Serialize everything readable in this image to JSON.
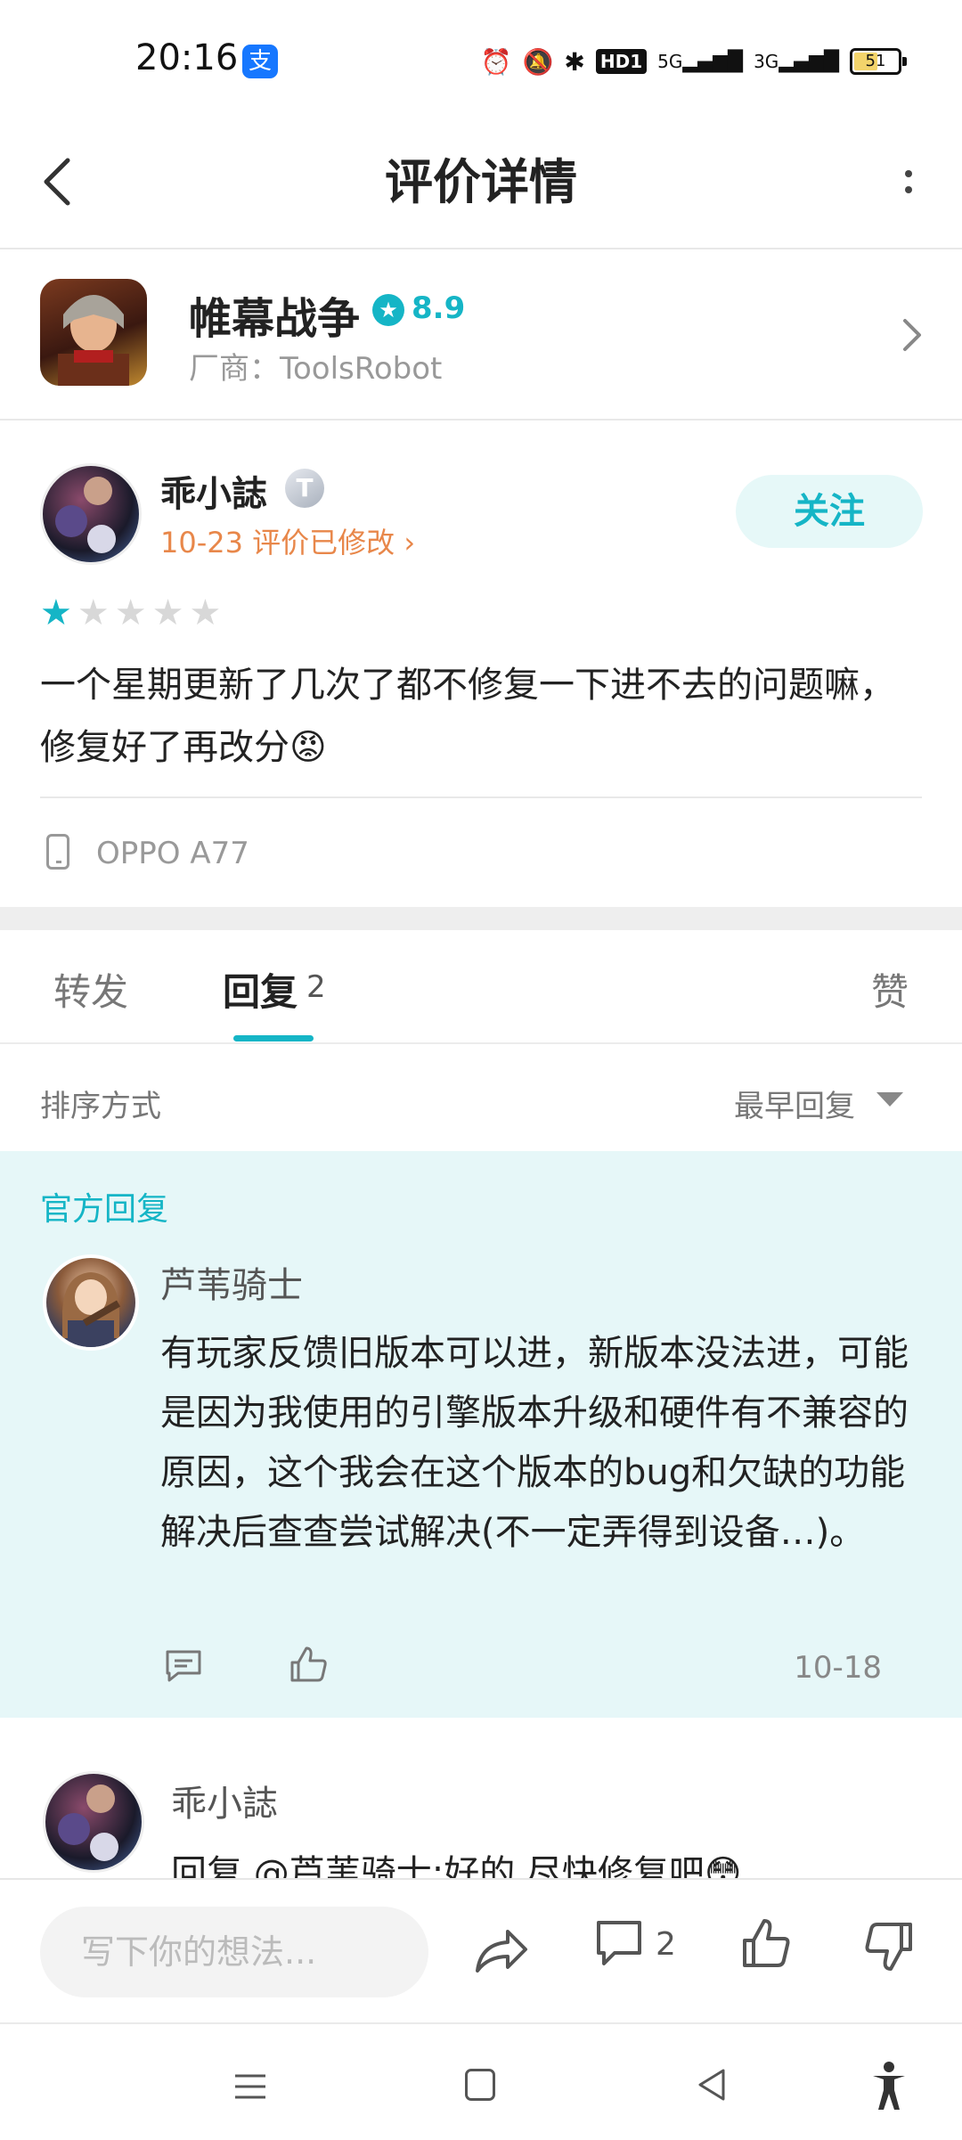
{
  "status_bar": {
    "time": "20:16",
    "app_icon": "alipay-icon",
    "icons": [
      "alarm-icon",
      "mute-icon",
      "bluetooth-icon",
      "hd-icon",
      "5g-signal-icon",
      "3g-signal-icon"
    ],
    "hd_label": "HD1",
    "net1_label": "5G",
    "net2_label": "3G",
    "battery": "51"
  },
  "header": {
    "title": "评价详情",
    "back_icon": "chevron-left-icon",
    "more_icon": "more-vertical-icon"
  },
  "game": {
    "name": "帷幕战争",
    "rating": "8.9",
    "vendor": "厂商：ToolsRobot"
  },
  "review": {
    "author": "乖小誌",
    "badge": "T",
    "meta": "10-23 评价已修改",
    "follow_label": "关注",
    "stars_filled": 1,
    "stars_total": 5,
    "text": "一个星期更新了几次了都不修复一下进不去的问题嘛，修复好了再改分😡",
    "device": "OPPO A77"
  },
  "tabs": {
    "repost": "转发",
    "reply": "回复",
    "reply_count": "2",
    "like": "赞"
  },
  "sort": {
    "label": "排序方式",
    "value": "最早回复"
  },
  "official_reply": {
    "label": "官方回复",
    "author": "芦苇骑士",
    "text": "有玩家反馈旧版本可以进，新版本没法进，可能是因为我使用的引擎版本升级和硬件有不兼容的原因，这个我会在这个版本的bug和欠缺的功能解决后查查尝试解决(不一定弄得到设备…)。",
    "date": "10-18"
  },
  "reply2": {
    "author": "乖小誌",
    "text": "回复 @芦苇骑士:好的 尽快修复吧😳"
  },
  "action_bar": {
    "input_placeholder": "写下你的想法...",
    "comment_count": "2"
  },
  "colors": {
    "accent": "#15b5c6",
    "meta_orange": "#e8874a",
    "official_bg": "#e6f7f8"
  }
}
